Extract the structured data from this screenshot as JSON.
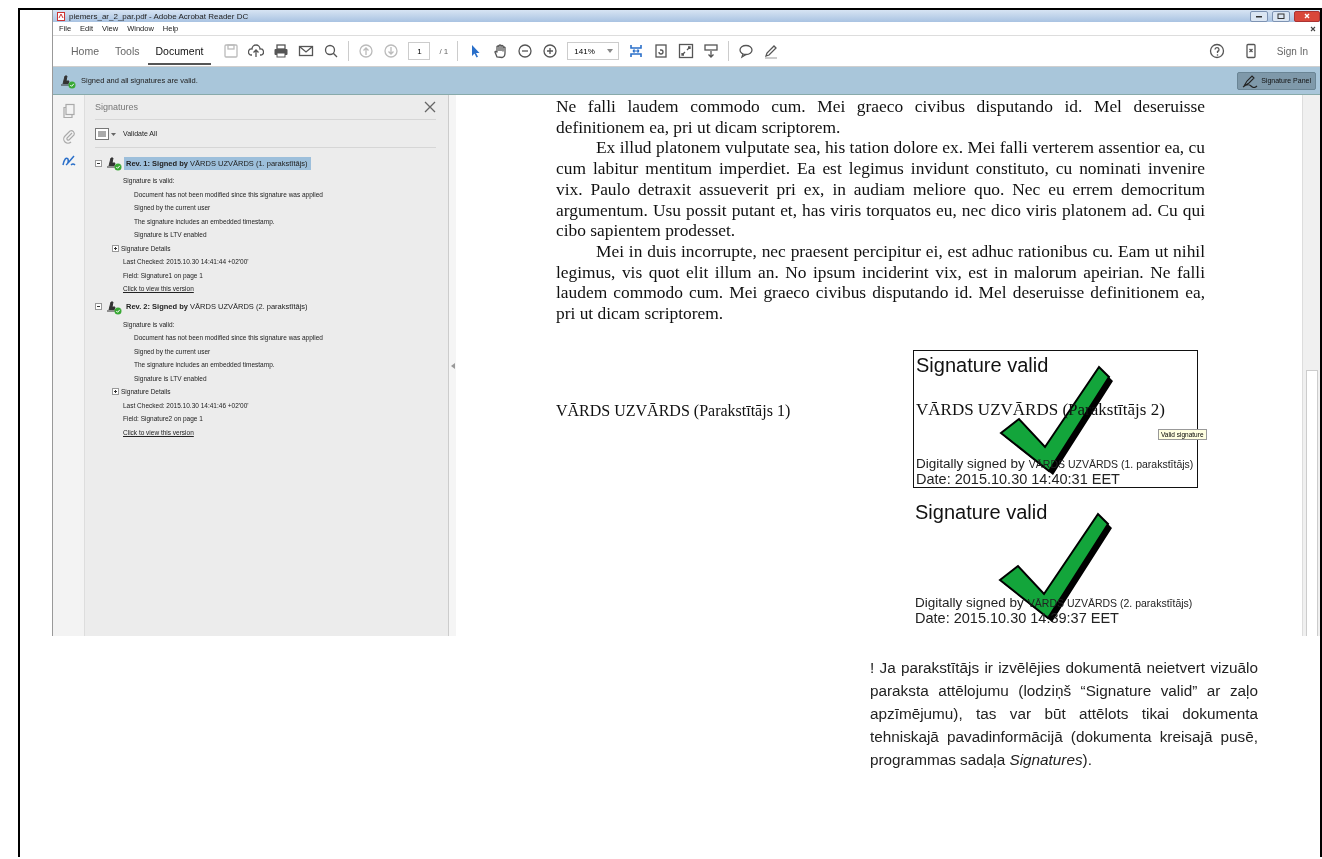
{
  "window": {
    "title": "piemers_ar_2_par.pdf - Adobe Acrobat Reader DC"
  },
  "menu": [
    "File",
    "Edit",
    "View",
    "Window",
    "Help"
  ],
  "toolbar": {
    "tabs": [
      {
        "label": "Home",
        "selected": false
      },
      {
        "label": "Tools",
        "selected": false
      },
      {
        "label": "Document",
        "selected": true
      }
    ],
    "page_number": "1",
    "page_total": "/ 1",
    "zoom": "141%",
    "sign_in": "Sign In"
  },
  "signature_bar": {
    "message": "Signed and all signatures are valid.",
    "button": "Signature Panel"
  },
  "side_rail": [
    {
      "kind": "pages",
      "selected": false
    },
    {
      "kind": "attachments",
      "selected": false
    },
    {
      "kind": "signatures",
      "selected": true
    }
  ],
  "panel": {
    "title": "Signatures",
    "validate_all": "Validate All",
    "signatures": [
      {
        "heading": "**Rev. 1: Signed by** VĀRDS UZVĀRDS (1. parakstītājs)",
        "selected": true,
        "expanded": true,
        "status": "Signature is valid:",
        "checks": [
          "Document has not been modified since this signature was applied",
          "Signed by the current user",
          "The signature includes an embedded timestamp.",
          "Signature is LTV enabled"
        ],
        "details": {
          "label": "Signature Details",
          "expanded": false
        },
        "last_checked": "Last Checked: 2015.10.30 14:41:44 +02'00'",
        "field": "Field: Signature1 on page 1",
        "link": "Click to view this version"
      },
      {
        "heading": "**Rev. 2: Signed by** VĀRDS UZVĀRDS (2. parakstītājs)",
        "selected": false,
        "expanded": true,
        "status": "Signature is valid:",
        "checks": [
          "Document has not been modified since this signature was applied",
          "Signed by the current user",
          "The signature includes an embedded timestamp.",
          "Signature is LTV enabled"
        ],
        "details": {
          "label": "Signature Details",
          "expanded": false
        },
        "last_checked": "Last Checked: 2015.10.30 14:41:46 +02'00'",
        "field": "Field: Signature2 on page 1",
        "link": "Click to view this version"
      }
    ]
  },
  "document": {
    "paragraphs": [
      {
        "text": "Ne falli laudem commodo cum. Mei graeco civibus disputando id. Mel deseruisse definitionem ea, pri ut dicam scriptorem.",
        "indent": false
      },
      {
        "text": "Ex illud platonem vulputate sea, his tation dolore ex. Mei falli verterem assentior ea, cu cum labitur mentitum imperdiet. Ea est legimus invidunt constituto, cu nominati invenire vix. Paulo detraxit assueverit pri ex, in audiam meliore quo. Nec eu errem democritum argumentum. Usu possit putant et, has viris torquatos eu, nec dico viris platonem ad. Cu qui cibo sapientem prodesset.",
        "indent": true
      },
      {
        "text": "Mei in duis incorrupte, nec praesent percipitur ei, est adhuc rationibus cu. Eam ut nihil legimus, vis quot elit illum an. No ipsum inciderint vix, est in malorum apeirian. Ne falli laudem commodo cum. Mei graeco civibus disputando id. Mel deseruisse definitionem ea, pri ut dicam scriptorem.",
        "indent": true
      }
    ],
    "signer_text": "VĀRDS UZVĀRDS (Parakstītājs 1)",
    "signature_fields": [
      {
        "title": "Signature valid",
        "name_line": "VĀRDS UZVĀRDS (Parakstītājs 2)",
        "signed_by": "Digitally signed by",
        "signer": "VĀRDS UZVĀRDS (1. parakstītājs)",
        "date": "Date: 2015.10.30 14:40:31 EET",
        "bordered": true,
        "tooltip": "Valid signature"
      },
      {
        "title": "Signature valid",
        "signed_by": "Digitally signed by",
        "signer": "VĀRDS UZVĀRDS (2. parakstītājs)",
        "date": "Date: 2015.10.30 14:39:37 EET",
        "bordered": false
      }
    ]
  },
  "note": "! Ja parakstītājs ir izvēlējies dokumentā neietvert vizuālo paraksta attēlojumu (lodziņš “Signature valid” ar zaļo apzīmējumu), tas var būt attēlots tikai dokumenta tehniskajā pavadinformācijā (dokumenta kreisajā pusē, programmas sadaļa *Signatures*)."
}
